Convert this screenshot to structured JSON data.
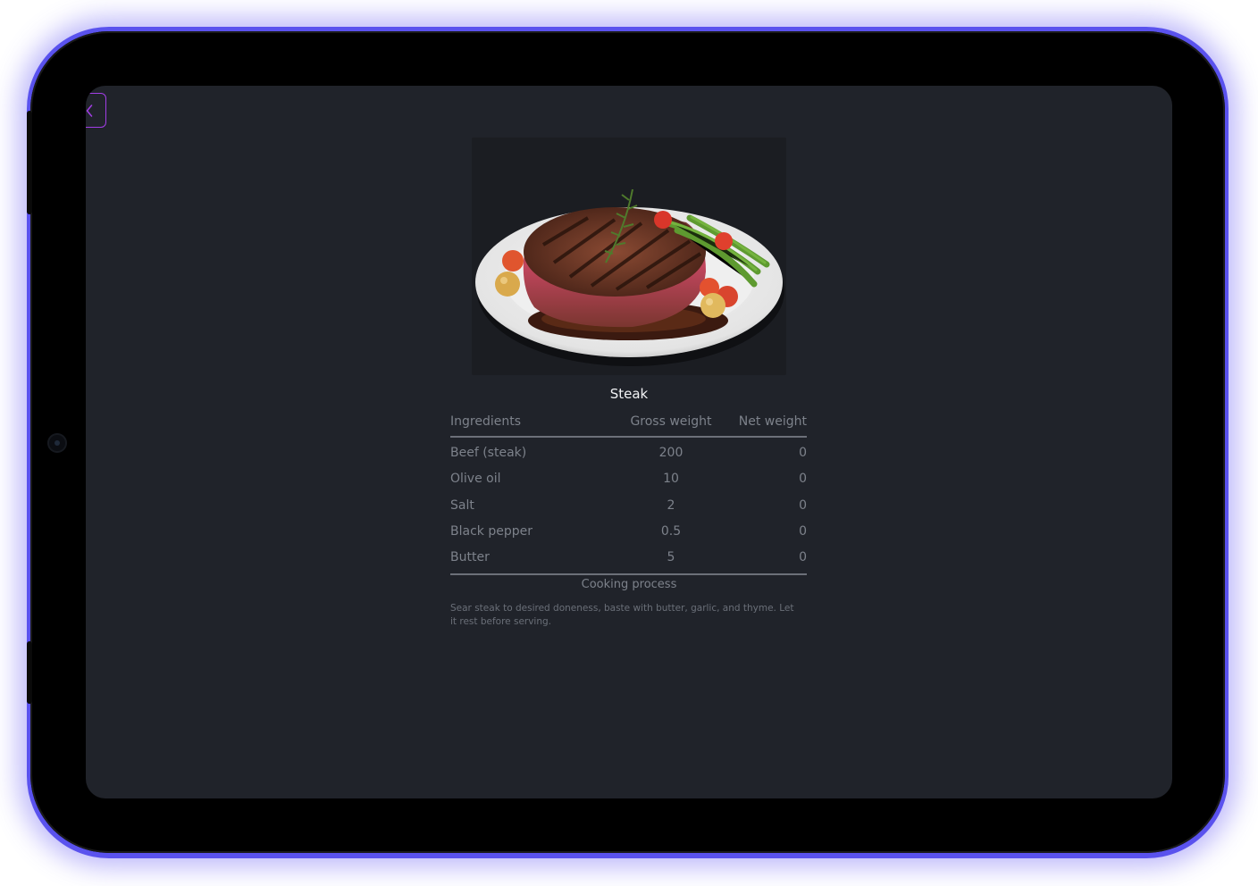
{
  "dish": {
    "name": "Steak",
    "image_subject": "grilled steak on white plate with green beans, cherry tomatoes and rosemary"
  },
  "table": {
    "headers": {
      "ingredient": "Ingredients",
      "gross": "Gross weight",
      "net": "Net weight"
    },
    "rows": [
      {
        "ingredient": "Beef (steak)",
        "gross": "200",
        "net": "0"
      },
      {
        "ingredient": "Olive oil",
        "gross": "10",
        "net": "0"
      },
      {
        "ingredient": "Salt",
        "gross": "2",
        "net": "0"
      },
      {
        "ingredient": "Black pepper",
        "gross": "0.5",
        "net": "0"
      },
      {
        "ingredient": "Butter",
        "gross": "5",
        "net": "0"
      }
    ]
  },
  "process": {
    "title": "Cooking process",
    "text": "Sear steak to desired doneness, baste with butter, garlic, and thyme. Let it rest before serving."
  },
  "icons": {
    "back": "chevron-left-icon"
  },
  "colors": {
    "accent": "#a23ee6",
    "device_glow": "#5a52ee",
    "screen_bg": "#20232a",
    "text_muted": "#7d828b",
    "title_text": "#f2f3f5"
  }
}
